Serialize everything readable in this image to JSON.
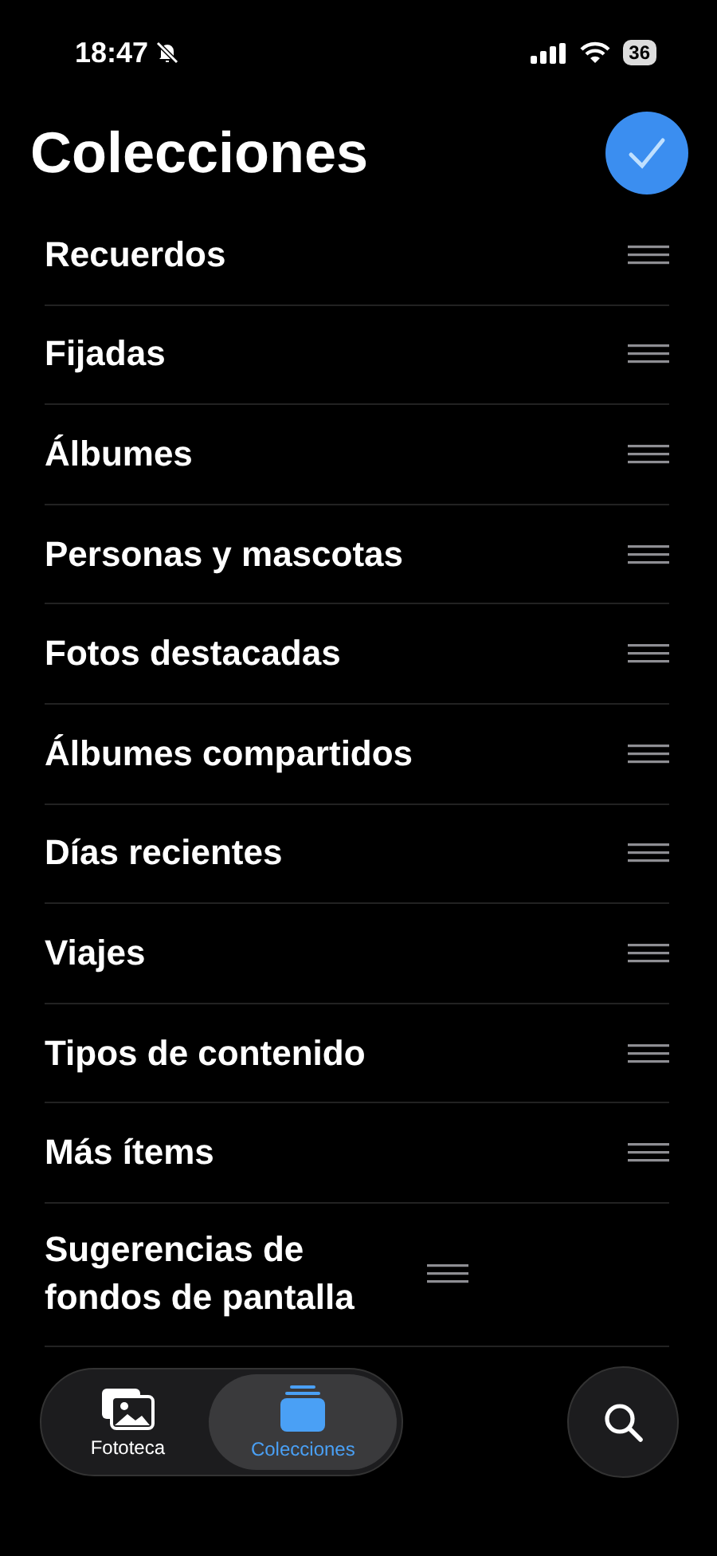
{
  "status_bar": {
    "time": "18:47",
    "silent": true,
    "battery": "36"
  },
  "header": {
    "title": "Colecciones",
    "done_button": true
  },
  "collections": [
    {
      "label": "Recuerdos"
    },
    {
      "label": "Fijadas"
    },
    {
      "label": "Álbumes"
    },
    {
      "label": "Personas y mascotas"
    },
    {
      "label": "Fotos destacadas"
    },
    {
      "label": "Álbumes compartidos"
    },
    {
      "label": "Días recientes"
    },
    {
      "label": "Viajes"
    },
    {
      "label": "Tipos de contenido"
    },
    {
      "label": "Más ítems"
    },
    {
      "label": "Sugerencias de fondos de pantalla"
    }
  ],
  "tab_bar": {
    "tabs": [
      {
        "label": "Fototeca",
        "kind": "library",
        "selected": false
      },
      {
        "label": "Colecciones",
        "kind": "collections",
        "selected": true
      }
    ],
    "search_button": true
  }
}
